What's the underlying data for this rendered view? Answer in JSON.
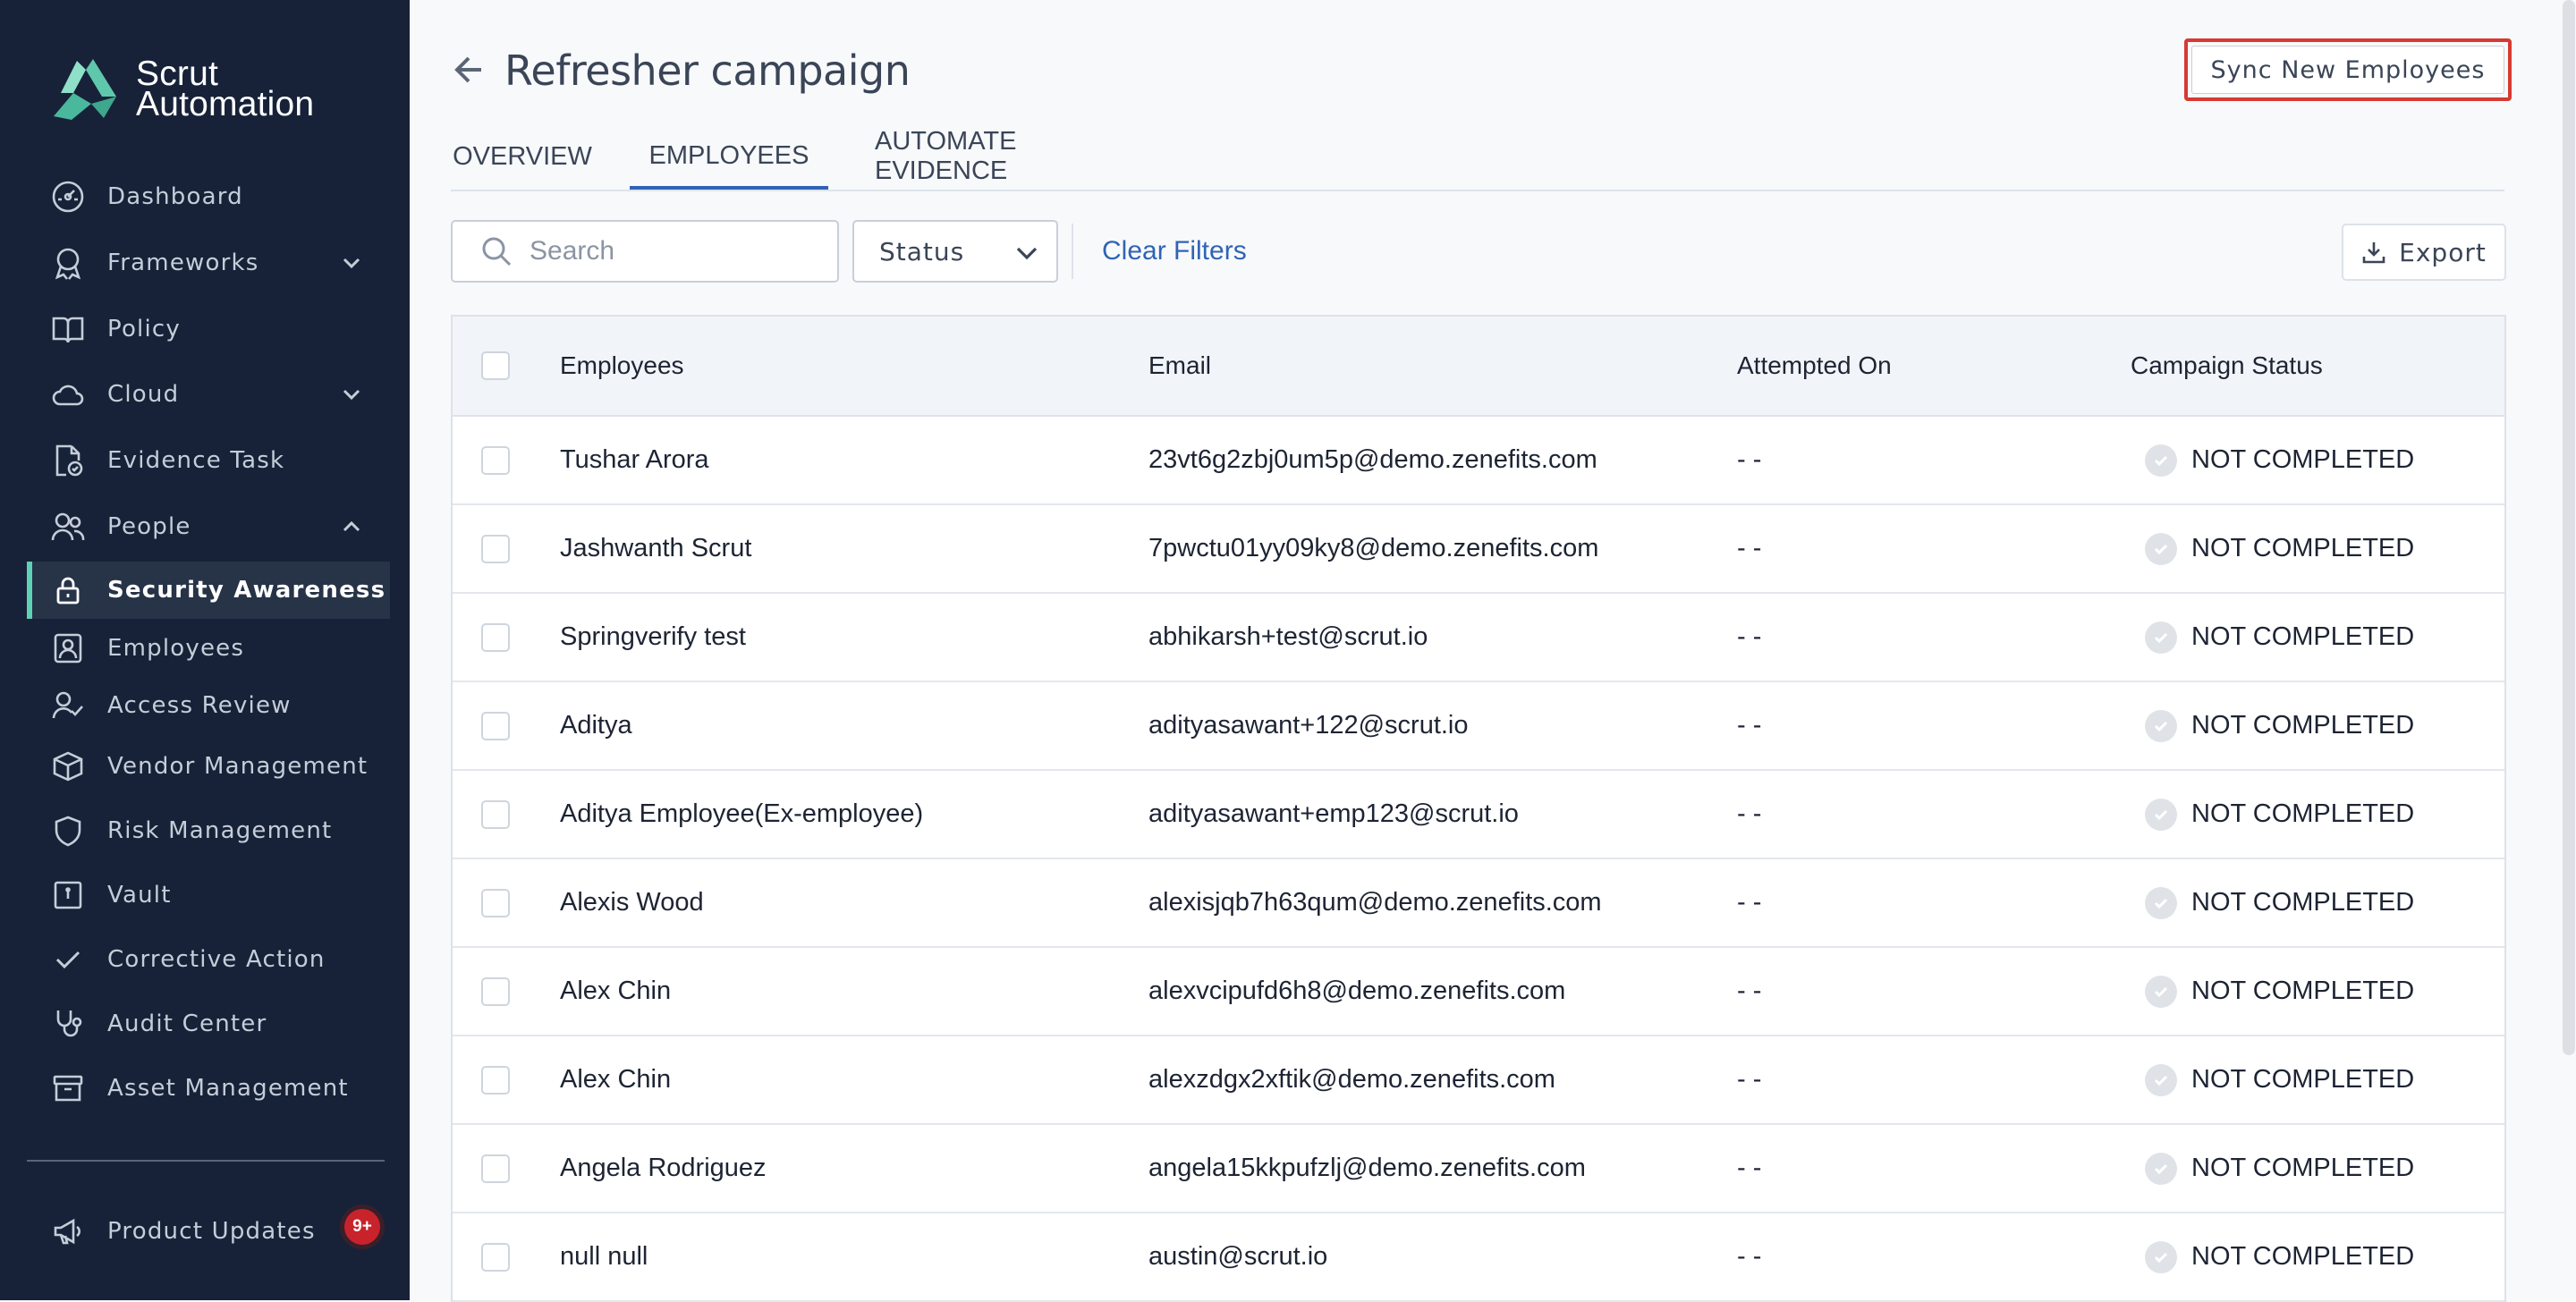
{
  "app": {
    "name_line1": "Scrut",
    "name_line2": "Automation"
  },
  "sidebar": {
    "items": [
      {
        "label": "Dashboard",
        "icon": "dashboard-icon"
      },
      {
        "label": "Frameworks",
        "icon": "award-icon"
      },
      {
        "label": "Policy",
        "icon": "book-icon"
      },
      {
        "label": "Cloud",
        "icon": "cloud-icon"
      },
      {
        "label": "Evidence Task",
        "icon": "file-check-icon"
      },
      {
        "label": "People",
        "icon": "users-icon"
      },
      {
        "label": "Security Awareness",
        "icon": "lock-icon"
      },
      {
        "label": "Employees",
        "icon": "id-badge-icon"
      },
      {
        "label": "Access Review",
        "icon": "user-check-icon"
      },
      {
        "label": "Vendor Management",
        "icon": "box-icon"
      },
      {
        "label": "Risk Management",
        "icon": "shield-icon"
      },
      {
        "label": "Vault",
        "icon": "vault-icon"
      },
      {
        "label": "Corrective Action",
        "icon": "check-icon"
      },
      {
        "label": "Audit Center",
        "icon": "stethoscope-icon"
      },
      {
        "label": "Asset Management",
        "icon": "archive-icon"
      }
    ],
    "product_updates": {
      "label": "Product Updates",
      "badge": "9+"
    }
  },
  "header": {
    "title": "Refresher campaign",
    "sync_button": "Sync New Employees"
  },
  "tabs": [
    {
      "label": "OVERVIEW"
    },
    {
      "label": "EMPLOYEES"
    },
    {
      "label": "AUTOMATE EVIDENCE"
    }
  ],
  "filters": {
    "search_placeholder": "Search",
    "status_label": "Status",
    "clear_label": "Clear Filters",
    "export_label": "Export"
  },
  "table": {
    "columns": [
      "Employees",
      "Email",
      "Attempted On",
      "Campaign Status"
    ],
    "rows": [
      {
        "name": "Tushar Arora",
        "email": "23vt6g2zbj0um5p@demo.zenefits.com",
        "attempted": "- -",
        "status": "NOT COMPLETED"
      },
      {
        "name": "Jashwanth Scrut",
        "email": "7pwctu01yy09ky8@demo.zenefits.com",
        "attempted": "- -",
        "status": "NOT COMPLETED"
      },
      {
        "name": "Springverify test",
        "email": "abhikarsh+test@scrut.io",
        "attempted": "- -",
        "status": "NOT COMPLETED"
      },
      {
        "name": "Aditya",
        "email": "adityasawant+122@scrut.io",
        "attempted": "- -",
        "status": "NOT COMPLETED"
      },
      {
        "name": "Aditya Employee(Ex-employee)",
        "email": "adityasawant+emp123@scrut.io",
        "attempted": "- -",
        "status": "NOT COMPLETED"
      },
      {
        "name": "Alexis Wood",
        "email": "alexisjqb7h63qum@demo.zenefits.com",
        "attempted": "- -",
        "status": "NOT COMPLETED"
      },
      {
        "name": "Alex Chin",
        "email": "alexvcipufd6h8@demo.zenefits.com",
        "attempted": "- -",
        "status": "NOT COMPLETED"
      },
      {
        "name": "Alex Chin",
        "email": "alexzdgx2xftik@demo.zenefits.com",
        "attempted": "- -",
        "status": "NOT COMPLETED"
      },
      {
        "name": "Angela Rodriguez",
        "email": "angela15kkpufzlj@demo.zenefits.com",
        "attempted": "- -",
        "status": "NOT COMPLETED"
      },
      {
        "name": "null null",
        "email": "austin@scrut.io",
        "attempted": "- -",
        "status": "NOT COMPLETED"
      }
    ]
  },
  "colors": {
    "sidebar_bg": "#172238",
    "accent": "#2f64b5",
    "active_marker": "#5fd1b4",
    "highlight_border": "#d63a32",
    "badge": "#c8232b"
  }
}
